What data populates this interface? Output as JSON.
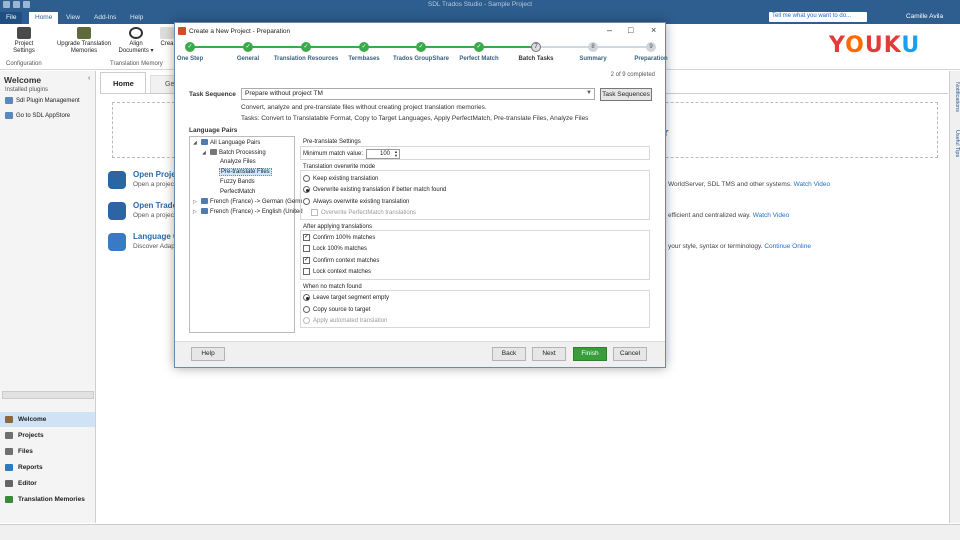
{
  "window": {
    "title": "SDL Trados Studio - Sample Project"
  },
  "menubar": {
    "tabs": [
      "File",
      "Home",
      "View",
      "Add-Ins",
      "Help"
    ],
    "tell_me": "Tell me what you want to do...",
    "user": "Camille Avila"
  },
  "ribbon": {
    "buttons": [
      {
        "label": "Project\nSettings",
        "icon": "project-settings-icon"
      },
      {
        "label": "Upgrade Translation\nMemories",
        "icon": "upgrade-tm-icon"
      },
      {
        "label": "Align\nDocuments ▾",
        "icon": "align-documents-icon"
      },
      {
        "label": "Crea",
        "icon": "create-icon"
      }
    ],
    "groups": [
      "Configuration",
      "Translation Memory"
    ],
    "watermark": "YOUKU"
  },
  "left_pane": {
    "title": "Welcome",
    "installed_label": "Installed plugins",
    "items": [
      "Sdl Plugin Management",
      "Go to SDL AppStore"
    ],
    "nav": [
      "Welcome",
      "Projects",
      "Files",
      "Reports",
      "Editor",
      "Translation Memories"
    ]
  },
  "main": {
    "tabs": [
      "Home",
      "Get"
    ],
    "banner_fragment": "er",
    "actions": [
      {
        "title": "Open Proje",
        "desc": "Open a project"
      },
      {
        "title": "Open Trade",
        "desc": "Open a project"
      },
      {
        "title": "Language C",
        "desc": "Discover Adap"
      }
    ],
    "right_texts": [
      {
        "text": "WorldServer, SDL TMS and other systems.",
        "link": "Watch Video"
      },
      {
        "text": "efficient and centralized way.",
        "link": "Watch Video"
      },
      {
        "text": "your style, syntax or terminology.",
        "link": "Continue Online"
      }
    ],
    "rail_labels": [
      "Notifications",
      "Useful Tips"
    ]
  },
  "dialog": {
    "title": "Create a New Project - Preparation",
    "steps": [
      {
        "label": "One Step",
        "state": "done",
        "num": "✓"
      },
      {
        "label": "General",
        "state": "done",
        "num": "✓"
      },
      {
        "label": "Translation Resources",
        "state": "done",
        "num": "✓"
      },
      {
        "label": "Termbases",
        "state": "done",
        "num": "✓"
      },
      {
        "label": "Trados GroupShare",
        "state": "done",
        "num": "✓"
      },
      {
        "label": "Perfect Match",
        "state": "done",
        "num": "✓"
      },
      {
        "label": "Batch Tasks",
        "state": "current",
        "num": "7"
      },
      {
        "label": "Summary",
        "state": "future",
        "num": "8"
      },
      {
        "label": "Preparation",
        "state": "future",
        "num": "9"
      }
    ],
    "completed": "2 of 9 completed",
    "task_sequence_label": "Task Sequence",
    "task_sequence_value": "Prepare without project TM",
    "task_sequences_button": "Task Sequences",
    "description": "Convert, analyze and pre-translate files without creating project translation memories.",
    "tasks": "Tasks: Convert to Translatable Format, Copy to Target Languages, Apply PerfectMatch, Pre-translate Files, Analyze Files",
    "language_pairs_label": "Language Pairs",
    "tree": [
      {
        "label": "All Language Pairs"
      },
      {
        "label": "Batch Processing"
      },
      {
        "label": "Analyze Files"
      },
      {
        "label": "Pre-translate Files"
      },
      {
        "label": "Fuzzy Bands"
      },
      {
        "label": "PerfectMatch"
      },
      {
        "label": "French (France) -> German (Germ"
      },
      {
        "label": "French (France) -> English (United"
      }
    ],
    "pretranslate_settings": "Pre-translate Settings",
    "min_match_label": "Minimum match value:",
    "min_match_value": "100",
    "overwrite_mode": {
      "title": "Translation overwrite mode",
      "options": [
        {
          "label": "Keep existing translation",
          "checked": false
        },
        {
          "label": "Overwrite existing translation if better match found",
          "checked": true
        },
        {
          "label": "Always overwrite existing translation",
          "checked": false
        }
      ],
      "sub_option": "Overwrite PerfectMatch translations"
    },
    "after_applying": {
      "title": "After applying translations",
      "options": [
        {
          "label": "Confirm 100% matches",
          "checked": true
        },
        {
          "label": "Lock 100% matches",
          "checked": false
        },
        {
          "label": "Confirm context matches",
          "checked": true
        },
        {
          "label": "Lock context matches",
          "checked": false
        }
      ]
    },
    "no_match": {
      "title": "When no match found",
      "options": [
        {
          "label": "Leave target segment empty",
          "checked": true
        },
        {
          "label": "Copy source to target",
          "checked": false
        },
        {
          "label": "Apply automated translation",
          "checked": false
        }
      ]
    },
    "buttons": {
      "help": "Help",
      "back": "Back",
      "next": "Next",
      "finish": "Finish",
      "cancel": "Cancel"
    }
  },
  "colors": {
    "titlebar": "#2d5e8f",
    "step_done": "#3aaa4a",
    "finish_button": "#3a9c3a",
    "link": "#1f6fc4"
  }
}
